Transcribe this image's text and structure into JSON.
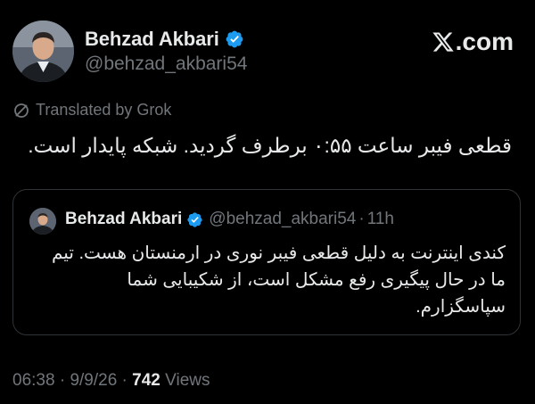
{
  "author": {
    "name": "Behzad Akbari",
    "handle": "@behzad_akbari54"
  },
  "brand": {
    "label": ".com",
    "icon": "x-logo-icon"
  },
  "translation": {
    "label": "Translated by Grok",
    "icon": "grok-icon"
  },
  "tweet": {
    "text": "قطعی فیبر ساعت ۰:۵۵ برطرف گردید. شبکه پایدار است."
  },
  "quoted_tweet": {
    "name": "Behzad Akbari",
    "handle": "@behzad_akbari54",
    "separator": "·",
    "time": "11h",
    "text": "کندی اینترنت به دلیل قطعی فیبر نوری در ارمنستان هست. تیم ما در حال پیگیری رفع مشکل است، از شکیبایی شما سپاسگزارم."
  },
  "meta": {
    "time": "06:38",
    "separator": "·",
    "date": "9/9/26",
    "views_count": "742",
    "views_label": "Views"
  },
  "colors": {
    "background": "#000000",
    "text": "#e7e9ea",
    "secondary": "#71767b",
    "verified": "#1d9bf0",
    "border": "#2f3336"
  }
}
